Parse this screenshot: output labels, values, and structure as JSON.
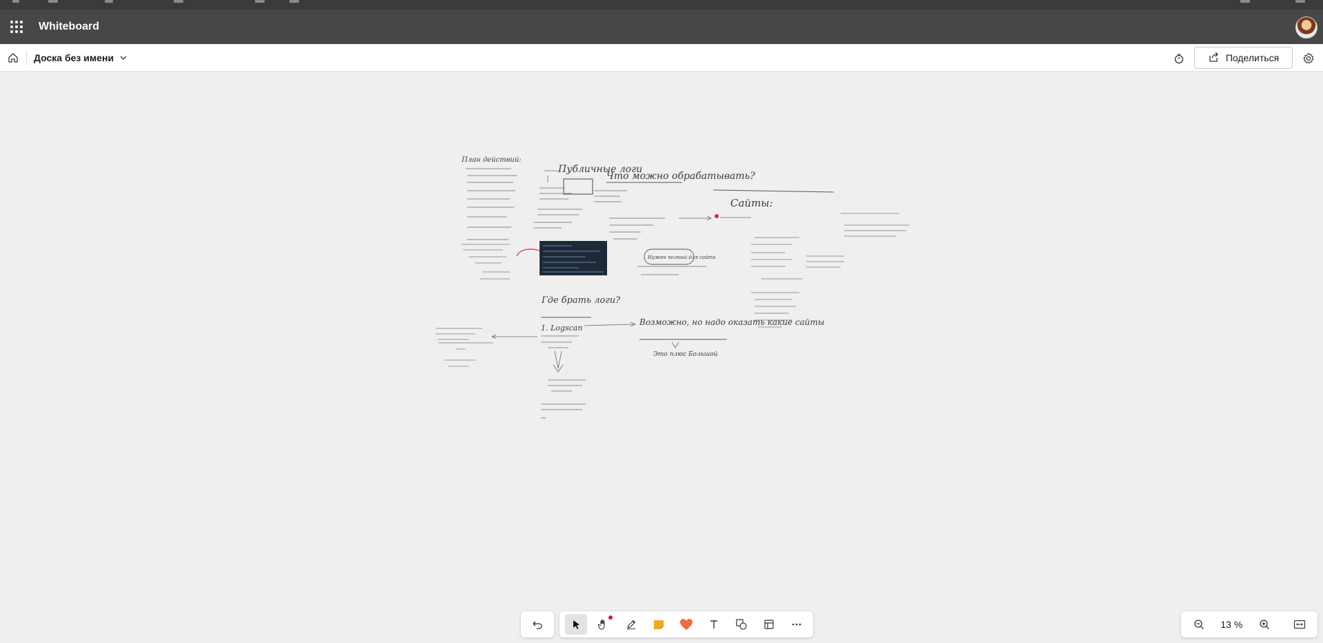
{
  "app": {
    "title": "Whiteboard"
  },
  "board": {
    "name": "Доска без имени",
    "share_label": "Поделиться"
  },
  "zoom": {
    "level": "13 %"
  },
  "icons": {
    "apps": "waffle-icon",
    "home": "home-icon",
    "chevron": "chevron-down-icon",
    "timer": "timer-icon",
    "share": "share-icon",
    "settings": "gear-icon",
    "undo": "undo-icon",
    "select": "cursor-icon",
    "pan": "hand-icon",
    "pen": "pen-icon",
    "note": "sticky-note-icon",
    "reaction": "heart-icon",
    "text": "text-icon",
    "shapes": "shapes-icon",
    "templates": "template-icon",
    "more": "more-icon",
    "zoom_out": "zoom-out-icon",
    "zoom_in": "zoom-in-icon",
    "fit": "fit-to-screen-icon"
  },
  "colors": {
    "header_bg": "#474747",
    "note_orange": "#f5a623",
    "reaction_red": "#f06a3c",
    "notification_dot": "#d8163b"
  },
  "canvas_notes": {
    "top_title": "Публичные логи",
    "what_title": "Что можно обрабатывать?",
    "sites_title": "Сайты:",
    "where_title": "Где брать логи?",
    "need_clean": "Нужен полный для сайта",
    "possible_note": "Возможно, но надо оказать какие сайты",
    "plus_note": "Это плюс Большой",
    "list_left": "План действий:",
    "log_item": "1. Logscan"
  }
}
